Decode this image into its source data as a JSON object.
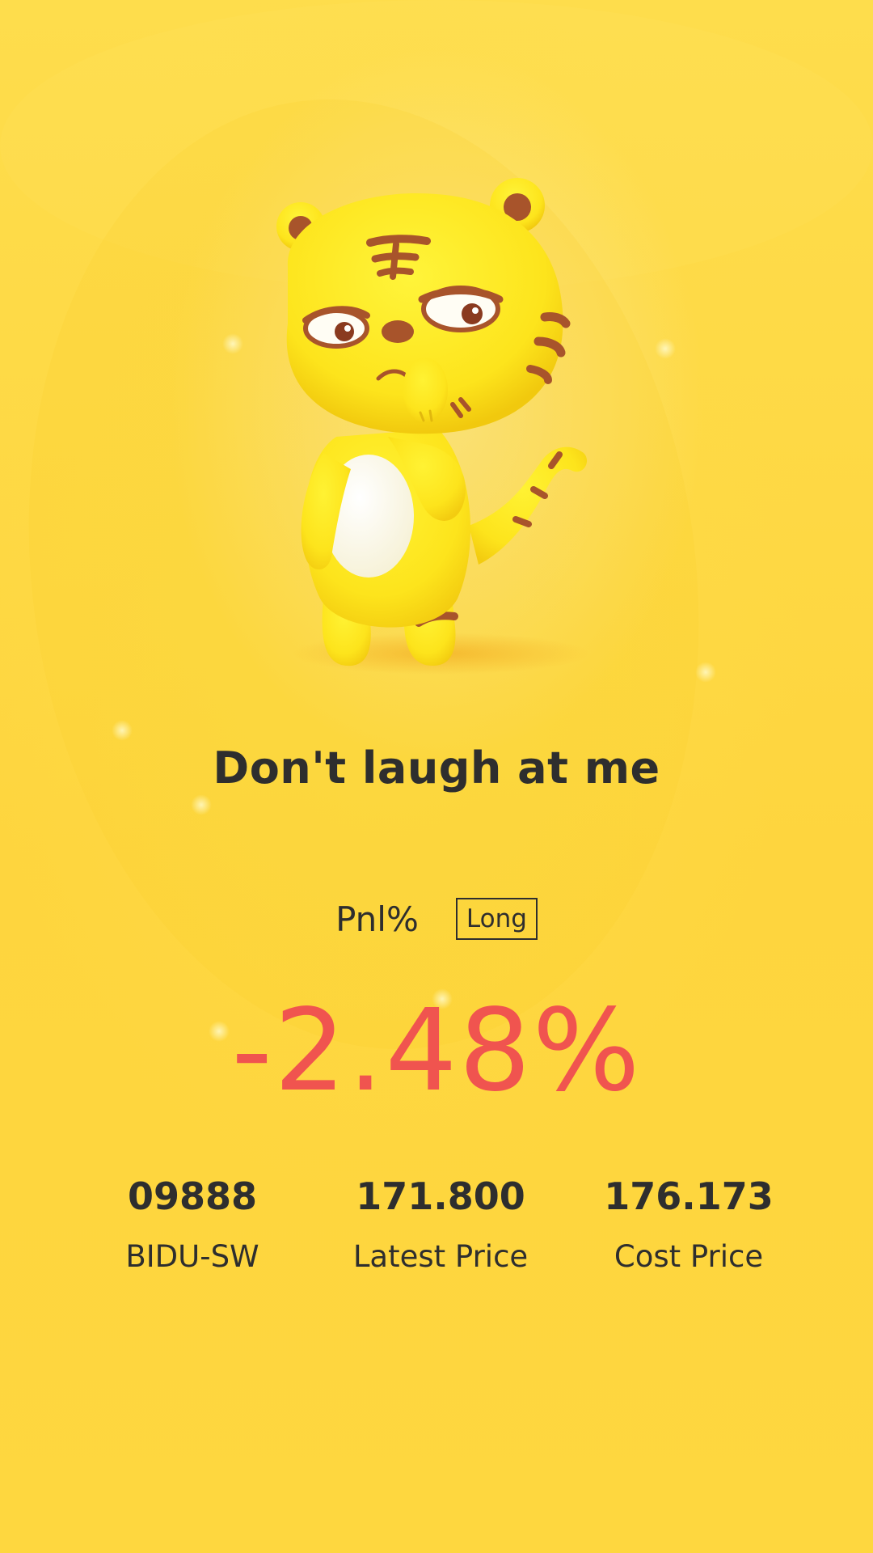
{
  "headline": "Don't laugh at me",
  "pnl": {
    "label": "Pnl%",
    "direction": "Long",
    "value": "-2.48%"
  },
  "stats": [
    {
      "value": "09888",
      "label": "BIDU-SW"
    },
    {
      "value": "171.800",
      "label": "Latest Price"
    },
    {
      "value": "176.173",
      "label": "Cost Price"
    }
  ],
  "colors": {
    "background": "#fed84a",
    "text": "#2e2e2e",
    "loss": "#f0544f",
    "mascot_body": "#fde21f",
    "mascot_stripes": "#a8542b"
  },
  "icons": {
    "mascot": "yellow-tiger-mascot"
  }
}
